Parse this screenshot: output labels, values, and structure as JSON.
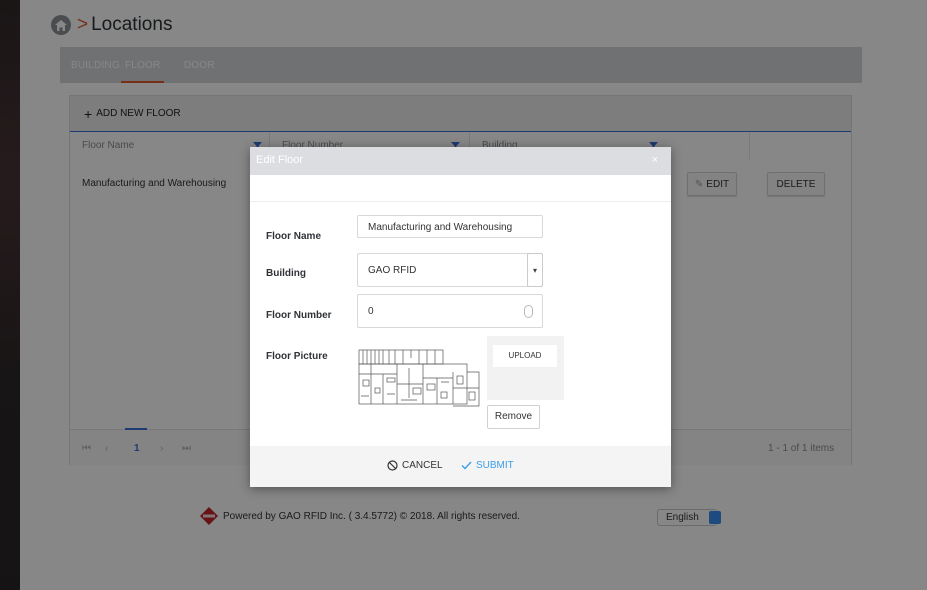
{
  "header": {
    "breadcrumb_sep": ">",
    "title": "Locations",
    "home_icon": "home-icon"
  },
  "tabs": [
    {
      "label": "BUILDING",
      "active": false
    },
    {
      "label": "FLOOR",
      "active": true
    },
    {
      "label": "DOOR",
      "active": false
    }
  ],
  "grid": {
    "add_label": "ADD NEW FLOOR",
    "columns": [
      "Floor Name",
      "Floor Number",
      "Building"
    ],
    "rows": [
      {
        "floor_name": "Manufacturing and Warehousing"
      }
    ],
    "edit_label": "EDIT",
    "delete_label": "DELETE",
    "pager": {
      "first": "⏮",
      "prev": "‹",
      "page": "1",
      "next": "›",
      "last": "⏭",
      "summary": "1 - 1 of 1 items"
    }
  },
  "footer": {
    "text": "Powered by GAO RFID Inc. ( 3.4.5772) © 2018. All rights reserved.",
    "language": "English"
  },
  "modal": {
    "title": "Edit Floor",
    "close": "×",
    "fields": {
      "floor_name_label": "Floor Name",
      "floor_name_value": "Manufacturing and Warehousing",
      "building_label": "Building",
      "building_value": "GAO RFID",
      "floor_number_label": "Floor Number",
      "floor_number_value": "0",
      "floor_picture_label": "Floor Picture"
    },
    "upload_label": "UPLOAD",
    "remove_label": "Remove",
    "cancel_label": "CANCEL",
    "submit_label": "SUBMIT"
  },
  "colors": {
    "accent": "#e2592b",
    "primary": "#3a6fd8",
    "submit": "#3aa0e6"
  }
}
